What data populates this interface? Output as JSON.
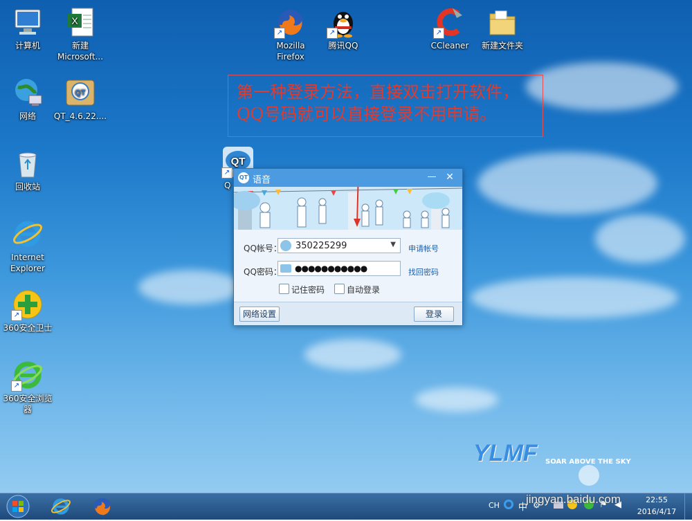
{
  "desktop": {
    "icons": [
      {
        "label": "计算机",
        "icon": "computer-icon",
        "shortcut": false
      },
      {
        "label": "新建Microsoft...",
        "icon": "excel-icon",
        "shortcut": false
      },
      {
        "label": "网络",
        "icon": "network-icon",
        "shortcut": false
      },
      {
        "label": "QT_4.6.22....",
        "icon": "qt-installer-icon",
        "shortcut": false
      },
      {
        "label": "回收站",
        "icon": "recycle-bin-icon",
        "shortcut": false
      },
      {
        "label": "Internet Explorer",
        "icon": "ie-icon",
        "shortcut": false
      },
      {
        "label": "360安全卫士",
        "icon": "360-guard-icon",
        "shortcut": true
      },
      {
        "label": "360安全浏览器",
        "icon": "360-browser-icon",
        "shortcut": true
      },
      {
        "label": "Mozilla Firefox",
        "icon": "firefox-icon",
        "shortcut": true
      },
      {
        "label": "腾讯QQ",
        "icon": "qq-penguin-icon",
        "shortcut": true
      },
      {
        "label": "CCleaner",
        "icon": "ccleaner-icon",
        "shortcut": true
      },
      {
        "label": "新建文件夹",
        "icon": "folder-icon",
        "shortcut": false
      },
      {
        "label": "Q",
        "icon": "qt-icon",
        "shortcut": true
      }
    ]
  },
  "annotation": {
    "line1": "第一种登录方法，直接双击打开软件，",
    "line2": "QQ号码就可以直接登录不用申请。"
  },
  "qt_window": {
    "title": "语音",
    "qq_account_label": "QQ帐号：",
    "qq_account_value": "350225299",
    "register_link": "申请帐号",
    "password_label": "QQ密码：",
    "password_value": "●●●●●●●●●●●",
    "recover_link": "找回密码",
    "remember_password": "记住密码",
    "auto_login": "自动登录",
    "network_settings": "网络设置",
    "login_button": "登录"
  },
  "watermark": {
    "logo": "YLMF",
    "tagline": "SOAR ABOVE THE SKY",
    "site": "jingyan.baidu.com"
  },
  "taskbar": {
    "ime": "CH",
    "ime_lang": "中",
    "time": "22:55",
    "date": "2016/4/17"
  },
  "colors": {
    "annotation_red": "#e33a2e",
    "titlebar_blue": "#4c9ae0",
    "link_blue": "#1d5ea8"
  }
}
